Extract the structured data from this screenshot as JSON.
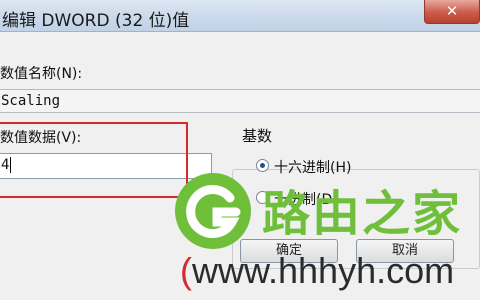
{
  "window": {
    "title": "编辑 DWORD (32 位)值",
    "close_glyph": "✕"
  },
  "form": {
    "name_label": "数值名称(N):",
    "name_value": "Scaling",
    "data_label": "数值数据(V):",
    "data_value": "4",
    "base_label": "基数",
    "base_options": [
      {
        "label": "十六进制(H)",
        "checked": true
      },
      {
        "label": "十进制(D)",
        "checked": false
      }
    ]
  },
  "buttons": {
    "ok": "确定",
    "cancel": "取消"
  },
  "watermark": {
    "brand": "路由之家",
    "url": "www.hhhyh.com",
    "url_prefix": "(",
    "colors": {
      "green": "#6fbf3b",
      "red": "#d8282b"
    }
  }
}
